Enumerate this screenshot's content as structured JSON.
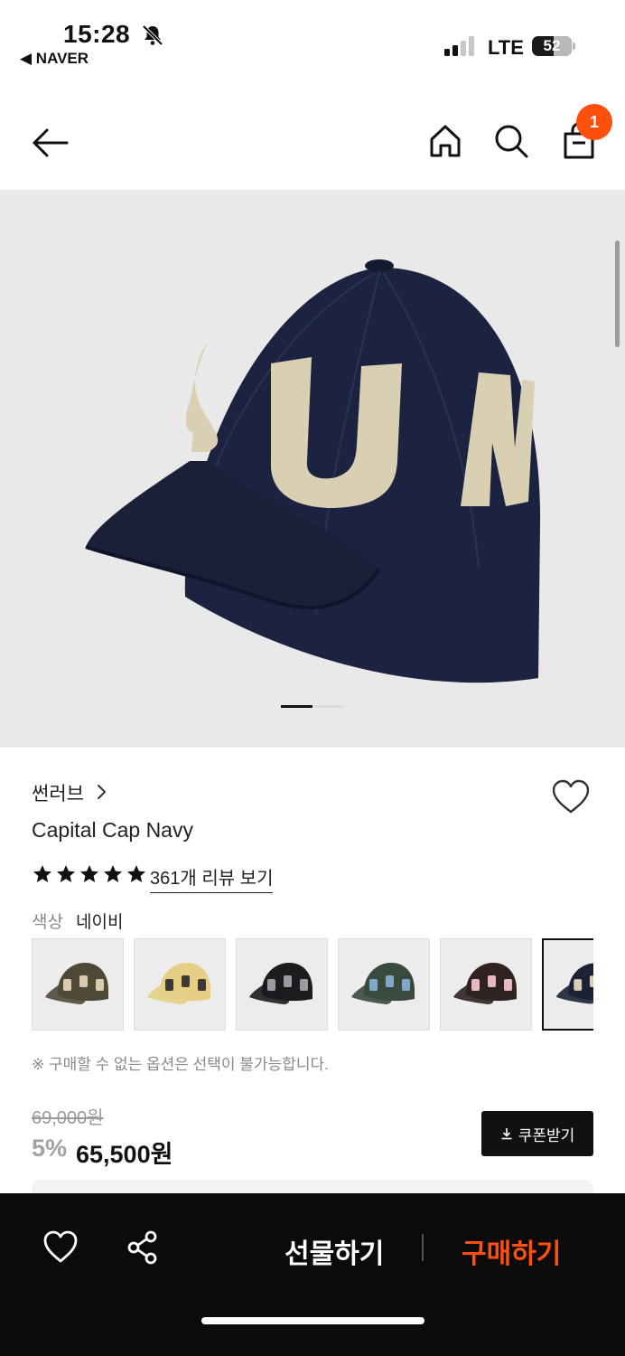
{
  "status_bar": {
    "time": "15:28",
    "back_app": "◀ NAVER",
    "network": "LTE",
    "battery": "52"
  },
  "nav": {
    "cart_count": "1"
  },
  "product": {
    "brand": "썬러브",
    "name": "Capital Cap Navy",
    "rating_stars": 5,
    "reviews_link": "361개 리뷰 보기",
    "color_label": "색상",
    "color_value": "네이비",
    "swatch_colors": [
      "#4f4a38",
      "#e6cf85",
      "#1c1c1f",
      "#3a4a3e",
      "#2e2320",
      "#1b2236"
    ],
    "swatch_letter_colors": [
      "#d8cbb0",
      "#3a3a3a",
      "#9a9aa0",
      "#7fa8cc",
      "#e6b8c4",
      "#d9cfb3"
    ],
    "notice": "※ 구매할 수 없는 옵션은 선택이 불가능합니다.",
    "original_price": "69,000원",
    "discount": "5%",
    "price": "65,500원",
    "coupon_label": "쿠폰받기"
  },
  "hero": {
    "cap_text": "SUN",
    "cap_color": "#1c2340",
    "letter_color": "#d9cfb3"
  },
  "bottom_bar": {
    "gift_label": "선물하기",
    "buy_label": "구매하기"
  }
}
